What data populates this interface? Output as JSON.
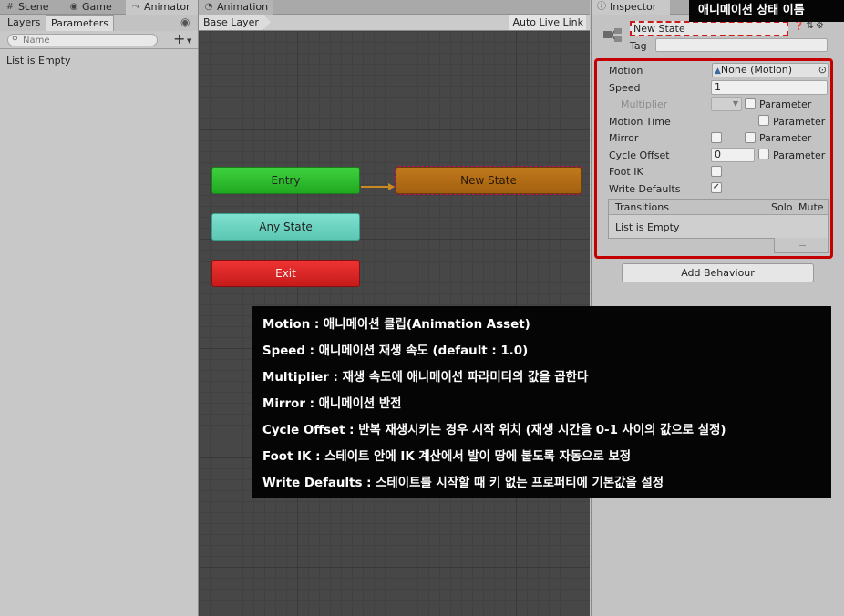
{
  "left": {
    "tabs": [
      {
        "label": "Scene",
        "icon": "grid-icon"
      },
      {
        "label": "Game",
        "icon": "gamepad-icon"
      },
      {
        "label": "Animator",
        "icon": "animator-icon"
      }
    ],
    "subtabs": [
      {
        "label": "Layers"
      },
      {
        "label": "Parameters"
      }
    ],
    "search_placeholder": "Name",
    "empty_text": "List is Empty"
  },
  "center": {
    "tab": {
      "label": "Animation",
      "icon": "animation-icon"
    },
    "layer": "Base Layer",
    "auto_live_link": "Auto Live Link",
    "nodes": {
      "entry": "Entry",
      "any_state": "Any State",
      "exit": "Exit",
      "new_state": "New State"
    },
    "colors": {
      "entry": "#2fbd2f",
      "any_state": "#6cd4c2",
      "exit": "#dd2727",
      "new_state": "#b26a15",
      "grid_bg": "#474747"
    }
  },
  "inspector": {
    "tab": "Inspector",
    "state_name": "New State",
    "tag_label": "Tag",
    "tag_value": "",
    "props": {
      "motion": {
        "label": "Motion",
        "value": "None (Motion)"
      },
      "speed": {
        "label": "Speed",
        "value": "1"
      },
      "multiplier": {
        "label": "Multiplier",
        "param": "Parameter",
        "checked": false
      },
      "motion_time": {
        "label": "Motion Time",
        "param": "Parameter",
        "checked": false
      },
      "mirror": {
        "label": "Mirror",
        "param": "Parameter",
        "checked": false,
        "param_checked": false
      },
      "cycle_offset": {
        "label": "Cycle Offset",
        "value": "0",
        "param": "Parameter",
        "checked": false
      },
      "foot_ik": {
        "label": "Foot IK",
        "checked": false
      },
      "write_defaults": {
        "label": "Write Defaults",
        "checked": true,
        "mark": "✓"
      }
    },
    "transitions": {
      "title": "Transitions",
      "solo": "Solo",
      "mute": "Mute",
      "empty_text": "List is Empty",
      "minus": "−"
    },
    "add_behaviour": "Add Behaviour",
    "highlight_color": "#c40000"
  },
  "annotations": {
    "title_callout": "애니메이션 상태 이름",
    "lines": [
      "Motion : 애니메이션 클립(Animation Asset)",
      "Speed : 애니메이션 재생 속도 (default : 1.0)",
      "Multiplier : 재생 속도에 애니메이션 파라미터의 값을 곱한다",
      "Mirror : 애니메이션 반전",
      "Cycle Offset : 반복 재생시키는 경우 시작 위치 (재생 시간을 0-1 사이의 값으로 설정)",
      "Foot IK : 스테이트 안에 IK 계산에서 발이 땅에 붙도록 자동으로 보정",
      "Write Defaults : 스테이트를 시작할 때 키 없는 프로퍼티에 기본값을 설정"
    ]
  }
}
